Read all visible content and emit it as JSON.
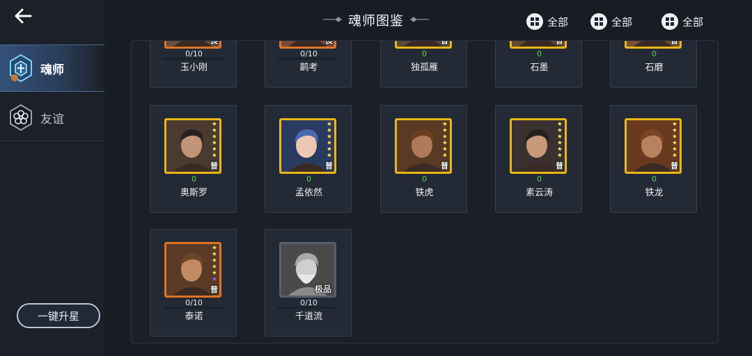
{
  "header": {
    "title": "魂师图鉴"
  },
  "filters": [
    {
      "label": "全部",
      "icon": "filter-grid-icon"
    },
    {
      "label": "全部",
      "icon": "filter-grid-icon"
    },
    {
      "label": "全部",
      "icon": "filter-grid-icon"
    }
  ],
  "sidebar": {
    "tabs": [
      {
        "label": "魂师",
        "icon": "soul-master-icon",
        "active": true
      },
      {
        "label": "友谊",
        "icon": "flower-icon",
        "active": false
      }
    ],
    "upgrade_button": "一键升星"
  },
  "cards": [
    {
      "name": "玉小刚",
      "count": "0/10",
      "rank": "良",
      "frame": "orange"
    },
    {
      "name": "鹋考",
      "count": "0/10",
      "rank": "良",
      "frame": "orange"
    },
    {
      "name": "独孤雁",
      "count": "0",
      "rank": "普",
      "frame": "gold"
    },
    {
      "name": "石墨",
      "count": "0",
      "rank": "普",
      "frame": "gold"
    },
    {
      "name": "石磨",
      "count": "0",
      "rank": "普",
      "frame": "gold"
    },
    {
      "name": "奥斯罗",
      "count": "0",
      "rank": "普",
      "frame": "gold"
    },
    {
      "name": "孟依然",
      "count": "0",
      "rank": "普",
      "frame": "gold"
    },
    {
      "name": "铁虎",
      "count": "0",
      "rank": "普",
      "frame": "gold"
    },
    {
      "name": "素云涛",
      "count": "0",
      "rank": "普",
      "frame": "gold"
    },
    {
      "name": "铁龙",
      "count": "0",
      "rank": "普",
      "frame": "gold"
    },
    {
      "name": "泰诺",
      "count": "0/10",
      "rank": "普",
      "frame": "orange"
    },
    {
      "name": "千道流",
      "count": "0/10",
      "rank": "极品",
      "frame": "gray"
    }
  ],
  "colors": {
    "background": "#181c25",
    "frame_gold": "#e8b818",
    "frame_orange": "#e07424",
    "count_green": "#5cd84a",
    "star": "#ffe566"
  }
}
